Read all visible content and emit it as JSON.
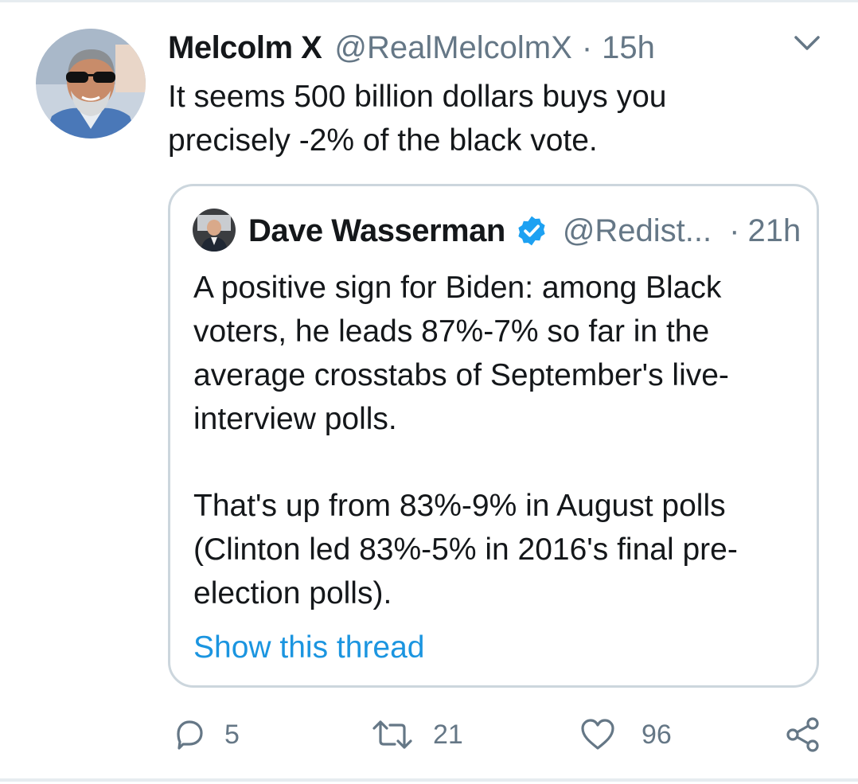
{
  "tweet": {
    "author_name": "Melcolm X",
    "author_handle": "@RealMelcolmX",
    "separator": "·",
    "time": "15h",
    "text": "It seems 500 billion dollars buys you precisely -2% of the black vote.",
    "chevron_icon": "chevron-down-icon"
  },
  "quoted_tweet": {
    "author_name": "Dave Wasserman",
    "verified_icon": "verified-badge-icon",
    "author_handle": "@Redist...",
    "separator": "·",
    "time": "21h",
    "paragraph_1": "A positive sign for Biden: among Black voters, he leads 87%-7% so far in the average crosstabs of September's live-interview polls.",
    "paragraph_2": "That's up from 83%-9% in August polls (Clinton led 83%-5% in 2016's final pre-election polls).",
    "show_thread": "Show this thread"
  },
  "actions": {
    "reply_count": "5",
    "retweet_count": "21",
    "like_count": "96"
  },
  "colors": {
    "text": "#14171a",
    "secondary": "#657786",
    "link": "#1b95e0",
    "border": "#ccd6dd",
    "verified": "#1da1f2"
  }
}
